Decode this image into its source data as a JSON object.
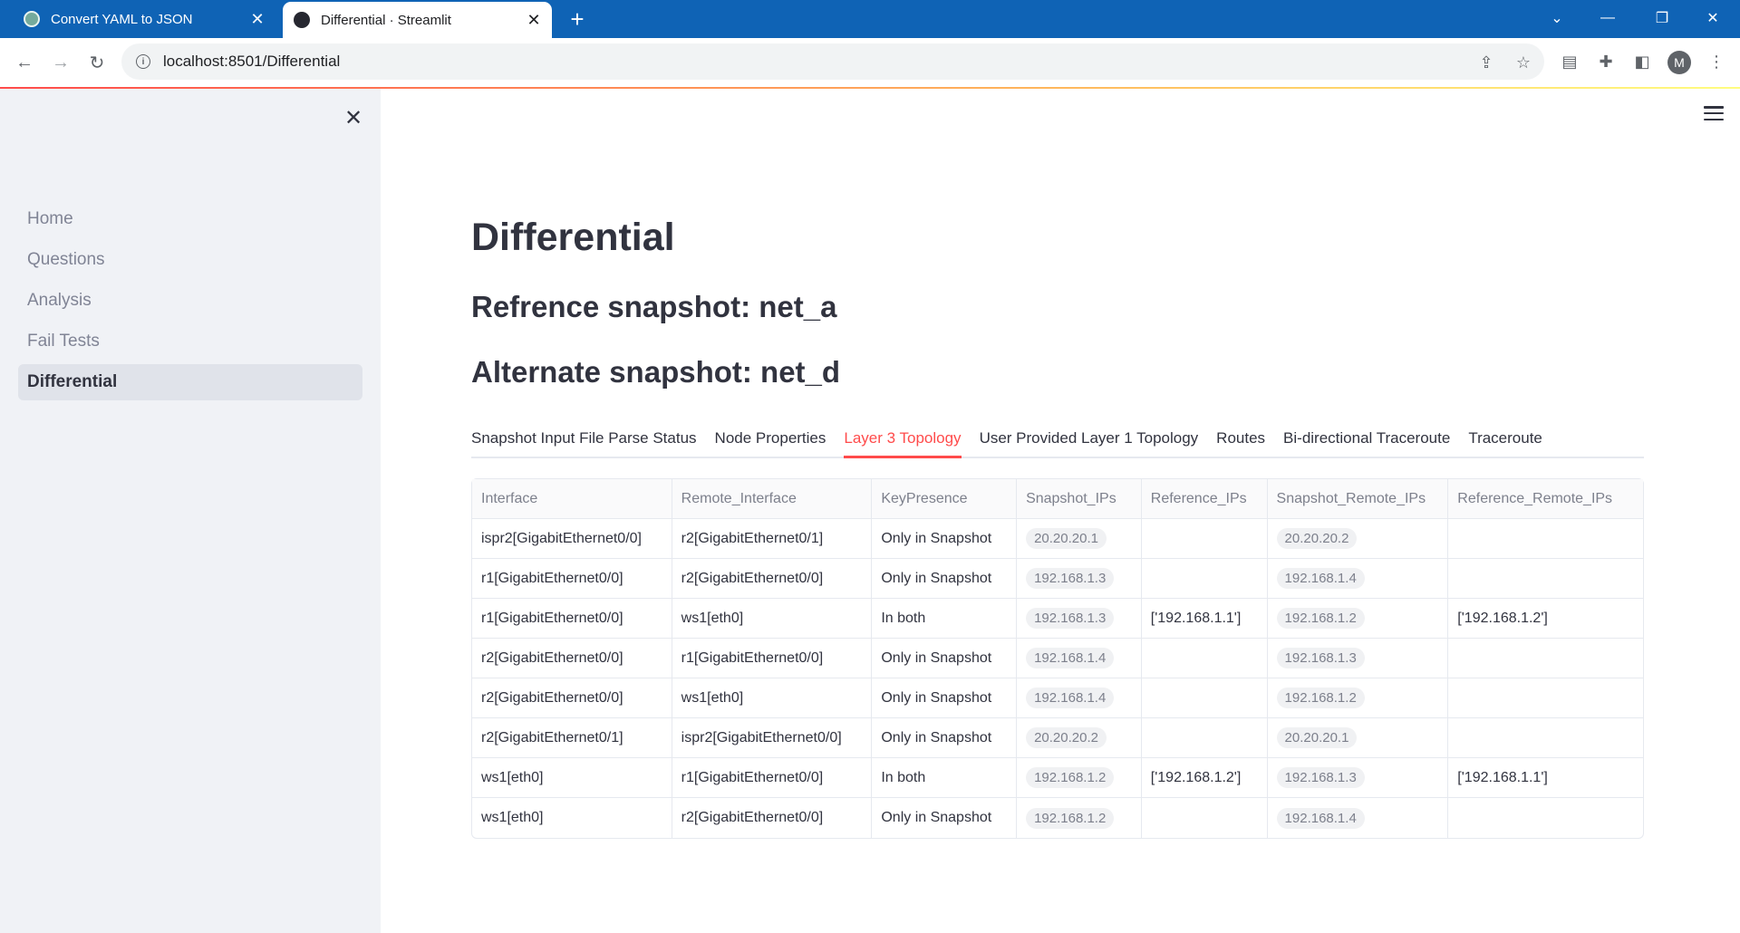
{
  "browser": {
    "tabs": [
      {
        "title": "Convert YAML to JSON",
        "active": false
      },
      {
        "title": "Differential · Streamlit",
        "active": true
      }
    ],
    "url": "localhost:8501/Differential",
    "profile_initial": "M",
    "accent": "#0f63b5"
  },
  "sidebar": {
    "items": [
      {
        "label": "Home",
        "active": false
      },
      {
        "label": "Questions",
        "active": false
      },
      {
        "label": "Analysis",
        "active": false
      },
      {
        "label": "Fail Tests",
        "active": false
      },
      {
        "label": "Differential",
        "active": true
      }
    ]
  },
  "main": {
    "title": "Differential",
    "reference": "Refrence snapshot: net_a",
    "alternate": "Alternate snapshot: net_d",
    "tabs": [
      {
        "label": "Snapshot Input File Parse Status",
        "active": false
      },
      {
        "label": "Node Properties",
        "active": false
      },
      {
        "label": "Layer 3 Topology",
        "active": true
      },
      {
        "label": "User Provided Layer 1 Topology",
        "active": false
      },
      {
        "label": "Routes",
        "active": false
      },
      {
        "label": "Bi-directional Traceroute",
        "active": false
      },
      {
        "label": "Traceroute",
        "active": false
      }
    ],
    "active_tab_color": "#ff4b4b"
  },
  "table": {
    "columns": [
      "Interface",
      "Remote_Interface",
      "KeyPresence",
      "Snapshot_IPs",
      "Reference_IPs",
      "Snapshot_Remote_IPs",
      "Reference_Remote_IPs"
    ],
    "rows": [
      [
        "ispr2[GigabitEthernet0/0]",
        "r2[GigabitEthernet0/1]",
        "Only in Snapshot",
        "20.20.20.1",
        "",
        "20.20.20.2",
        ""
      ],
      [
        "r1[GigabitEthernet0/0]",
        "r2[GigabitEthernet0/0]",
        "Only in Snapshot",
        "192.168.1.3",
        "",
        "192.168.1.4",
        ""
      ],
      [
        "r1[GigabitEthernet0/0]",
        "ws1[eth0]",
        "In both",
        "192.168.1.3",
        "['192.168.1.1']",
        "192.168.1.2",
        "['192.168.1.2']"
      ],
      [
        "r2[GigabitEthernet0/0]",
        "r1[GigabitEthernet0/0]",
        "Only in Snapshot",
        "192.168.1.4",
        "",
        "192.168.1.3",
        ""
      ],
      [
        "r2[GigabitEthernet0/0]",
        "ws1[eth0]",
        "Only in Snapshot",
        "192.168.1.4",
        "",
        "192.168.1.2",
        ""
      ],
      [
        "r2[GigabitEthernet0/1]",
        "ispr2[GigabitEthernet0/0]",
        "Only in Snapshot",
        "20.20.20.2",
        "",
        "20.20.20.1",
        ""
      ],
      [
        "ws1[eth0]",
        "r1[GigabitEthernet0/0]",
        "In both",
        "192.168.1.2",
        "['192.168.1.2']",
        "192.168.1.3",
        "['192.168.1.1']"
      ],
      [
        "ws1[eth0]",
        "r2[GigabitEthernet0/0]",
        "Only in Snapshot",
        "192.168.1.2",
        "",
        "192.168.1.4",
        ""
      ]
    ]
  }
}
